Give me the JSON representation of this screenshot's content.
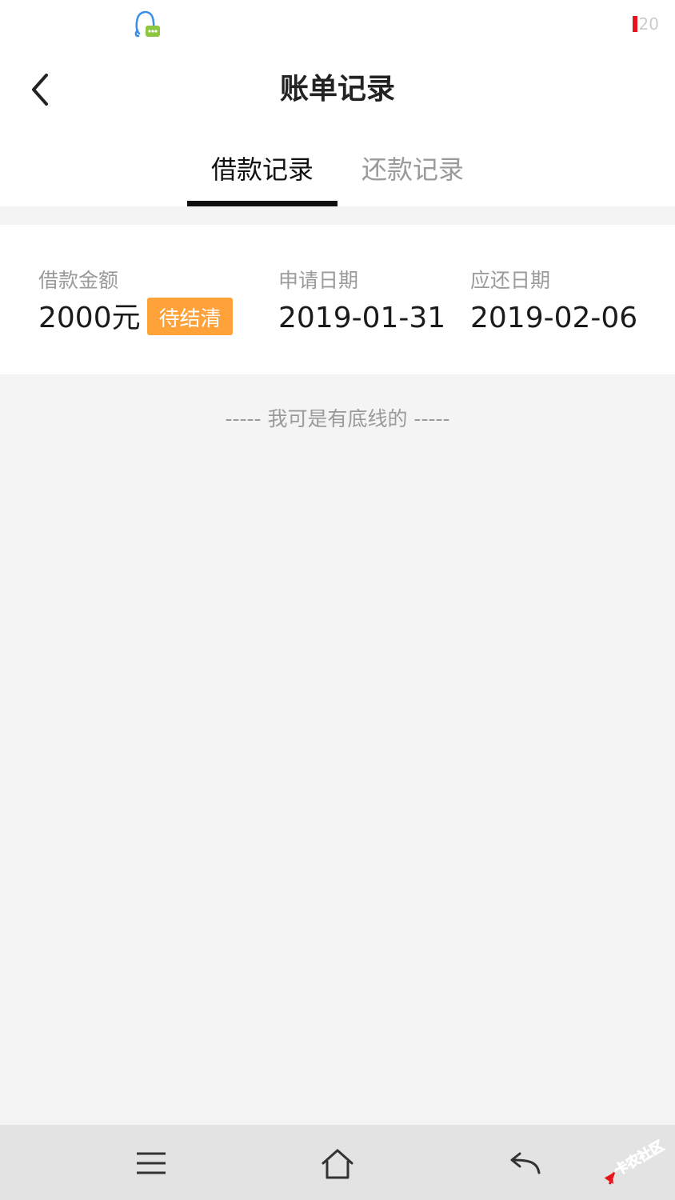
{
  "status_bar": {
    "battery_level": "20"
  },
  "header": {
    "title": "账单记录"
  },
  "tabs": [
    {
      "label": "借款记录",
      "active": true
    },
    {
      "label": "还款记录",
      "active": false
    }
  ],
  "record": {
    "amount_label": "借款金额",
    "amount_value": "2000元",
    "status": "待结清",
    "apply_date_label": "申请日期",
    "apply_date": "2019-01-31",
    "due_date_label": "应还日期",
    "due_date": "2019-02-06"
  },
  "footer_note": "----- 我可是有底线的 -----",
  "watermark": {
    "text": "卡农社区"
  },
  "colors": {
    "accent_badge": "#ffa23a",
    "page_background": "#f4f4f4",
    "battery_low": "#e8141c"
  },
  "icons": {
    "status_app": "chat-bubble-bot-icon",
    "back": "chevron-left-icon",
    "menu": "menu-icon",
    "home": "home-icon",
    "back_nav": "return-arrow-icon"
  }
}
